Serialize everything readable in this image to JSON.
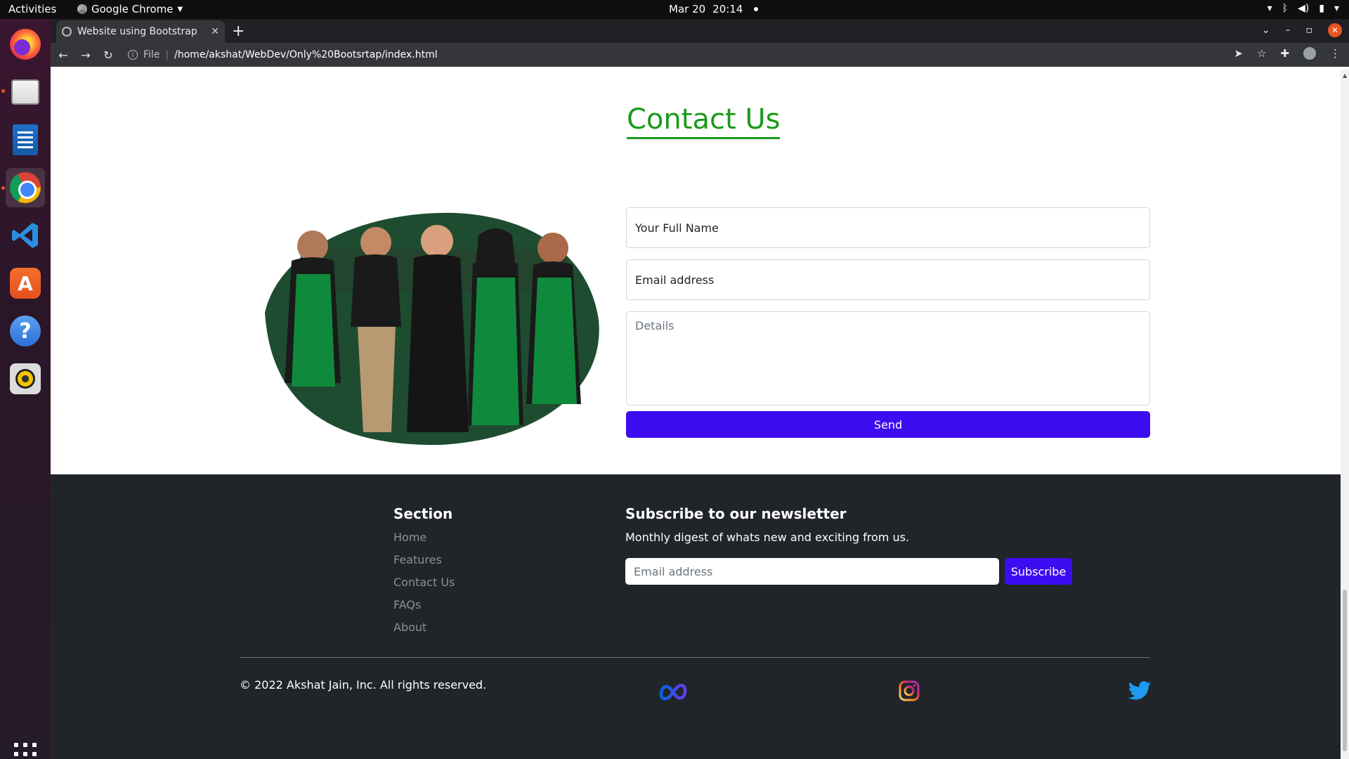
{
  "os": {
    "activities": "Activities",
    "app_name": "Google Chrome",
    "date": "Mar 20",
    "time": "20:14"
  },
  "browser": {
    "tab_title": "Website using Bootstrap",
    "url_scheme": "File",
    "url": "/home/akshat/WebDev/Only%20Bootsrtap/index.html"
  },
  "contact": {
    "title": "Contact Us",
    "name_placeholder": "Your Full Name",
    "email_placeholder": "Email address",
    "details_placeholder": "Details",
    "send_label": "Send"
  },
  "footer": {
    "section_title": "Section",
    "links": [
      "Home",
      "Features",
      "Contact Us",
      "FAQs",
      "About"
    ],
    "newsletter_title": "Subscribe to our newsletter",
    "newsletter_sub": "Monthly digest of whats new and exciting from us.",
    "email_placeholder": "Email address",
    "subscribe_label": "Subscribe",
    "copyright": "© 2022 Akshat Jain, Inc. All rights reserved."
  },
  "colors": {
    "accent_green": "#1a9a1a",
    "button_blue": "#3d0cf0",
    "footer_bg": "#212529"
  },
  "icons": [
    "meta-icon",
    "instagram-icon",
    "twitter-icon"
  ]
}
